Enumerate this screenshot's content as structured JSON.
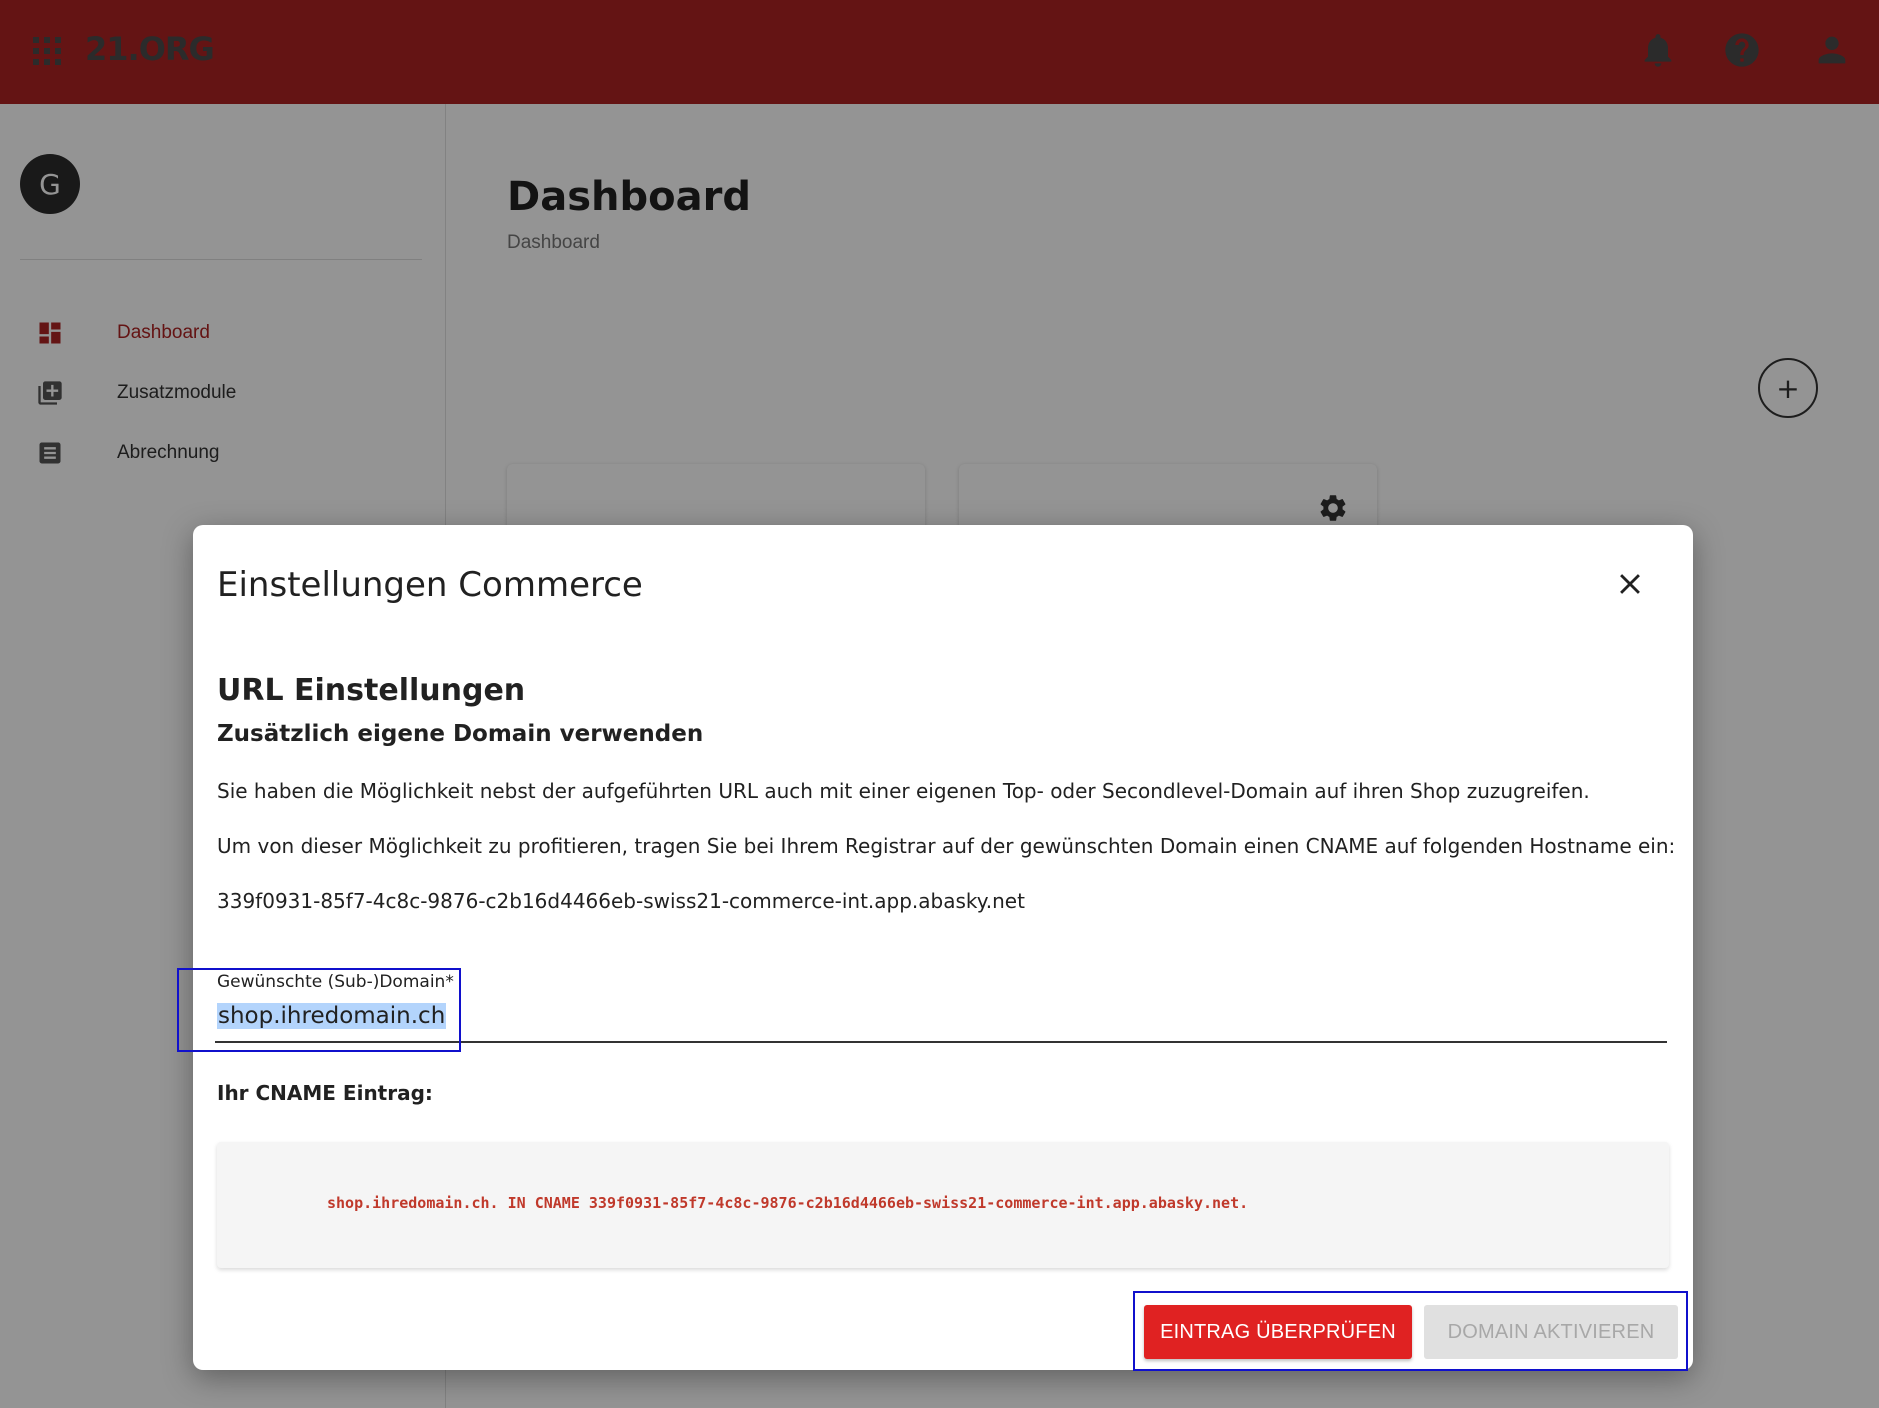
{
  "topbar": {
    "logo": "21.ORG",
    "icons": [
      "apps-icon",
      "bell-icon",
      "help-icon",
      "user-icon"
    ],
    "color": "#ad2424"
  },
  "sidebar": {
    "avatar_initial": "G",
    "items": [
      {
        "label": "Dashboard",
        "icon": "dashboard-icon",
        "active": true
      },
      {
        "label": "Zusatzmodule",
        "icon": "add-module-icon",
        "active": false
      },
      {
        "label": "Abrechnung",
        "icon": "invoice-icon",
        "active": false
      }
    ]
  },
  "main": {
    "title": "Dashboard",
    "breadcrumb": "Dashboard",
    "add_icon": "plus-icon",
    "widget_icon": "gear-icon"
  },
  "dialog": {
    "title": "Einstellungen Commerce",
    "close_icon": "close-icon",
    "section_title": "URL Einstellungen",
    "section_subtitle": "Zusätzlich eigene Domain verwenden",
    "paragraph_1": "Sie haben die Möglichkeit nebst der aufgeführten URL auch mit einer eigenen Top- oder Secondlevel-Domain auf ihren Shop zuzugreifen.",
    "paragraph_2": "Um von dieser Möglichkeit zu profitieren, tragen Sie bei Ihrem Registrar auf der gewünschten Domain einen CNAME auf folgenden Hostname ein:",
    "hostname": "339f0931-85f7-4c8c-9876-c2b16d4466eb-swiss21-commerce-int.app.abasky.net",
    "domain_field": {
      "label": "Gewünschte (Sub-)Domain*",
      "value": "shop.ihredomain.ch"
    },
    "cname_label": "Ihr CNAME Eintrag:",
    "cname_entry": "shop.ihredomain.ch. IN CNAME 339f0931-85f7-4c8c-9876-c2b16d4466eb-swiss21-commerce-int.app.abasky.net.",
    "buttons": {
      "check": "EINTRAG ÜBERPRÜFEN",
      "activate": "DOMAIN AKTIVIEREN"
    },
    "accent_color": "#e02222",
    "code_color": "#c0392b"
  }
}
